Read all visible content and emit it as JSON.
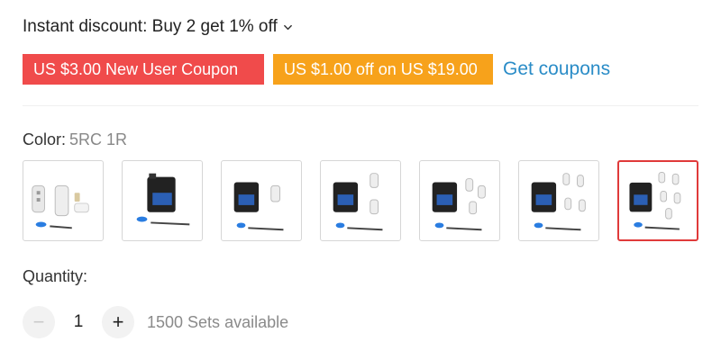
{
  "discount": {
    "label": "Instant discount: Buy 2 get 1% off",
    "icon": "chevron-down-icon"
  },
  "coupons": {
    "new_user": "US $3.00 New User Coupon",
    "off": "US $1.00 off on US $19.00",
    "get_coupons": "Get coupons",
    "colors": {
      "new_user": "#f04b4b",
      "off": "#f7a21b",
      "link": "#2a8cc7"
    }
  },
  "color": {
    "label": "Color:",
    "value": "5RC 1R",
    "selected_index": 6,
    "option_count": 7
  },
  "quantity": {
    "label": "Quantity:",
    "decrement": "−",
    "value": "1",
    "increment": "+",
    "available": "1500 Sets available"
  }
}
